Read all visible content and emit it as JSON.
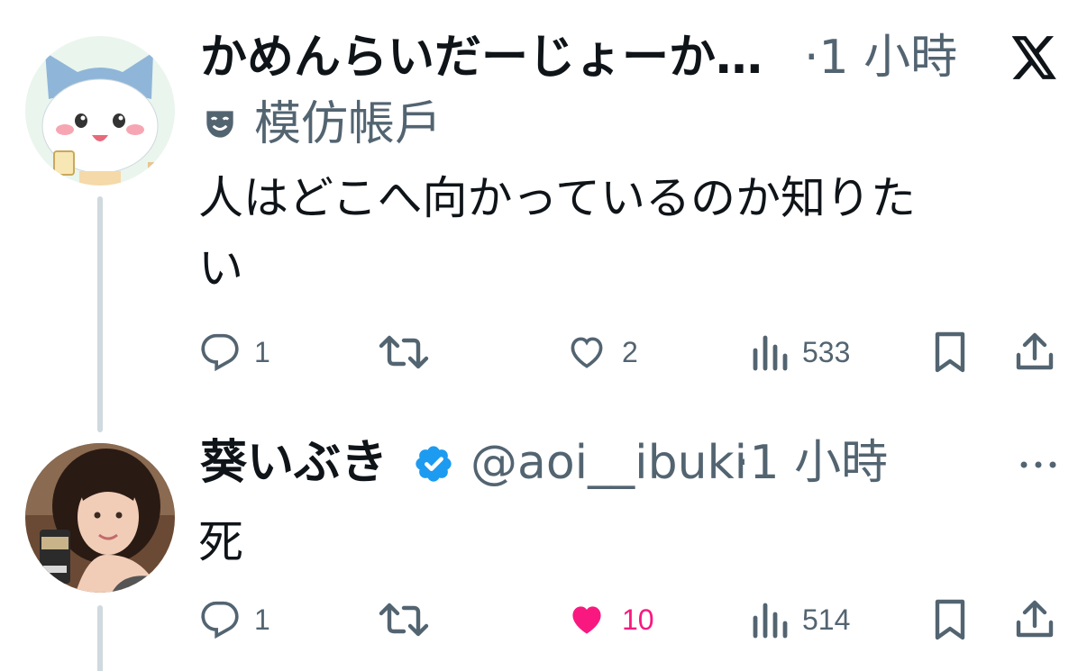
{
  "tweets": [
    {
      "display_name": "かめんらいだーじょーか…",
      "time": "·1 小時",
      "badge_label": "模仿帳戶",
      "text_line1": "人はどこへ向かっているのか知りた",
      "text_line2": "い",
      "stats": {
        "replies": "1",
        "likes": "2",
        "views": "533"
      },
      "liked": false
    },
    {
      "display_name": "葵いぶき",
      "handle": "@aoi__ibuki",
      "time": "·1 小時",
      "text": "死",
      "stats": {
        "replies": "1",
        "likes": "10",
        "views": "514"
      },
      "liked": true
    }
  ],
  "icons": {
    "platform_logo": "x-logo-icon",
    "parody": "theater-mask-icon",
    "verified": "verified-badge-icon",
    "more": "more-icon",
    "reply": "reply-icon",
    "retweet": "retweet-icon",
    "like": "heart-icon",
    "views": "views-icon",
    "bookmark": "bookmark-icon",
    "share": "share-icon"
  },
  "colors": {
    "text_primary": "#0f1419",
    "text_secondary": "#536471",
    "like_active": "#f91880",
    "verified_blue": "#1d9bf0",
    "thread_line": "#cfd9de"
  }
}
